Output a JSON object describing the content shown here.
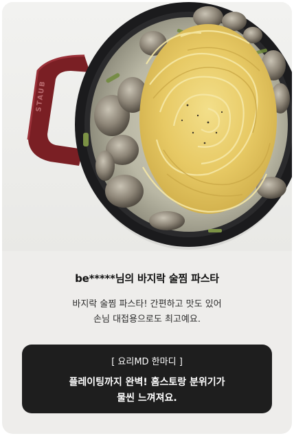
{
  "review": {
    "title": "be*****님의 바지락 술찜 파스타",
    "description_lines": [
      "바지락 술찜 파스타! 간편하고 맛도 있어",
      "손님 대접용으로도 최고예요."
    ]
  },
  "md_comment": {
    "label": "[ 요리MD 한마디 ]",
    "lines": [
      "플레이팅까지 완벽! 홈스토랑 분위기가",
      "물씬 느껴져요."
    ]
  },
  "photo": {
    "pan_brand_text": "STAUB"
  },
  "colors": {
    "card_background": "#eeedeb",
    "md_box_background": "#1e1e1e",
    "pan_handle": "#7a1f24",
    "pan_body": "#1b1b1d"
  }
}
